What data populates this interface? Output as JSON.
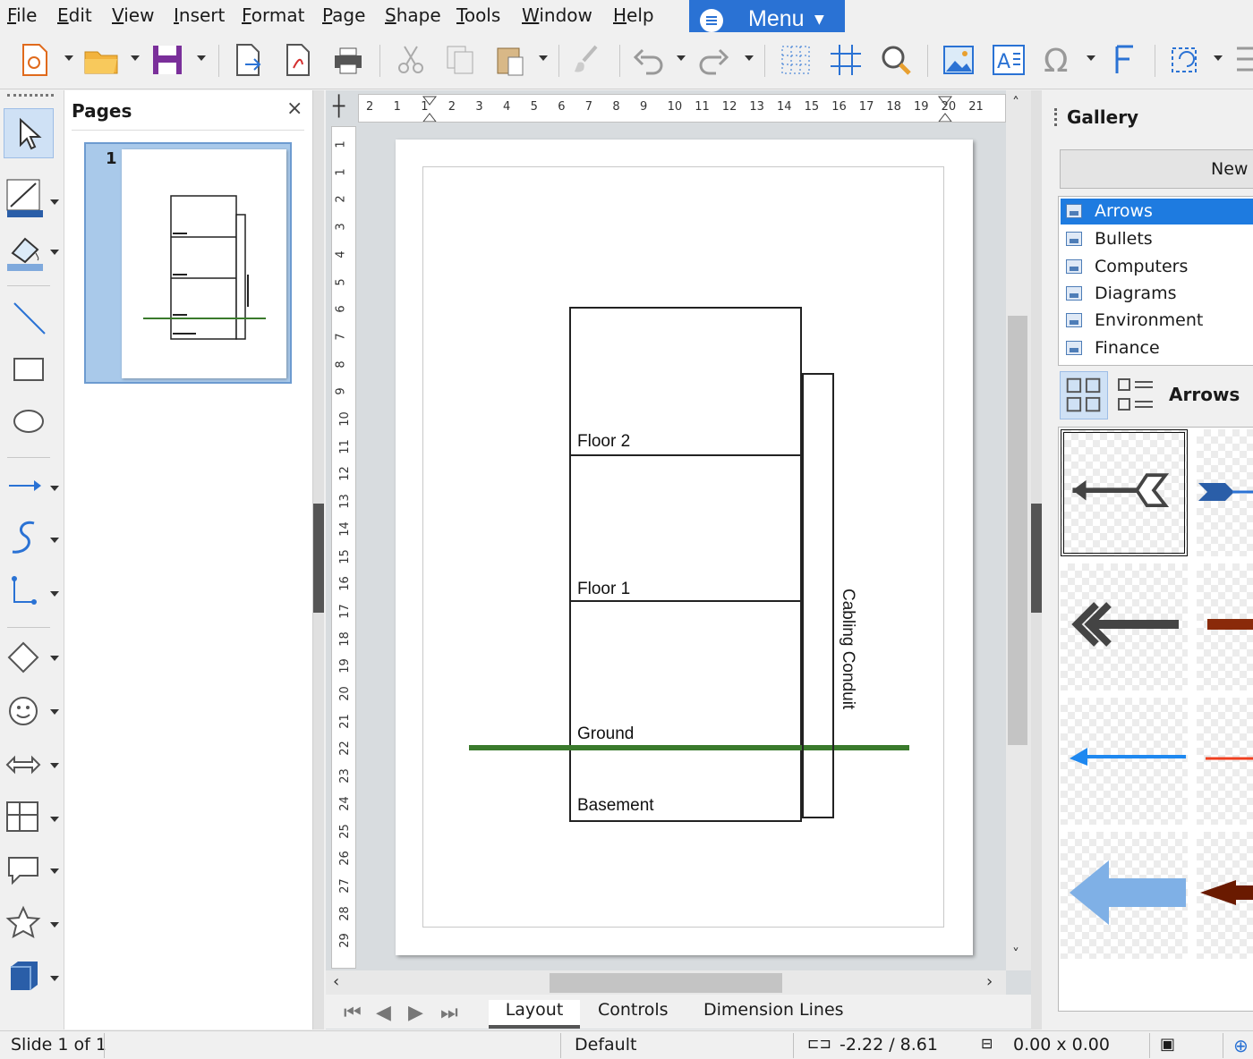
{
  "menubar": {
    "items": [
      "File",
      "Edit",
      "View",
      "Insert",
      "Format",
      "Page",
      "Shape",
      "Tools",
      "Window",
      "Help"
    ],
    "menu_button": "Menu"
  },
  "pages_panel": {
    "title": "Pages",
    "close": "×",
    "thumbnail_number": "1"
  },
  "hruler": {
    "ticks": [
      "2",
      "1",
      "1",
      "2",
      "3",
      "4",
      "5",
      "6",
      "7",
      "8",
      "9",
      "10",
      "11",
      "12",
      "13",
      "14",
      "15",
      "16",
      "17",
      "18",
      "19",
      "20",
      "21"
    ]
  },
  "vruler": {
    "ticks": [
      "1",
      "1",
      "2",
      "3",
      "4",
      "5",
      "6",
      "7",
      "8",
      "9",
      "10",
      "11",
      "12",
      "13",
      "14",
      "15",
      "16",
      "17",
      "18",
      "19",
      "20",
      "21",
      "22",
      "23",
      "24",
      "25",
      "26",
      "27",
      "28",
      "29"
    ]
  },
  "drawing": {
    "floors": [
      "Floor 2",
      "Floor 1",
      "Ground",
      "Basement"
    ],
    "conduit_label": "Cabling Conduit",
    "ground_color": "#3a7a2c"
  },
  "tabs": [
    "Layout",
    "Controls",
    "Dimension Lines"
  ],
  "gallery": {
    "title": "Gallery",
    "new_button": "New Theme...",
    "themes": [
      "Arrows",
      "Bullets",
      "Computers",
      "Diagrams",
      "Environment",
      "Finance"
    ],
    "selected_theme": "Arrows",
    "accent": "#1e7be0"
  },
  "statusbar": {
    "slide": "Slide 1 of 1",
    "master": "Default",
    "position": "-2.22 / 8.61",
    "size": "0.00 x 0.00"
  }
}
